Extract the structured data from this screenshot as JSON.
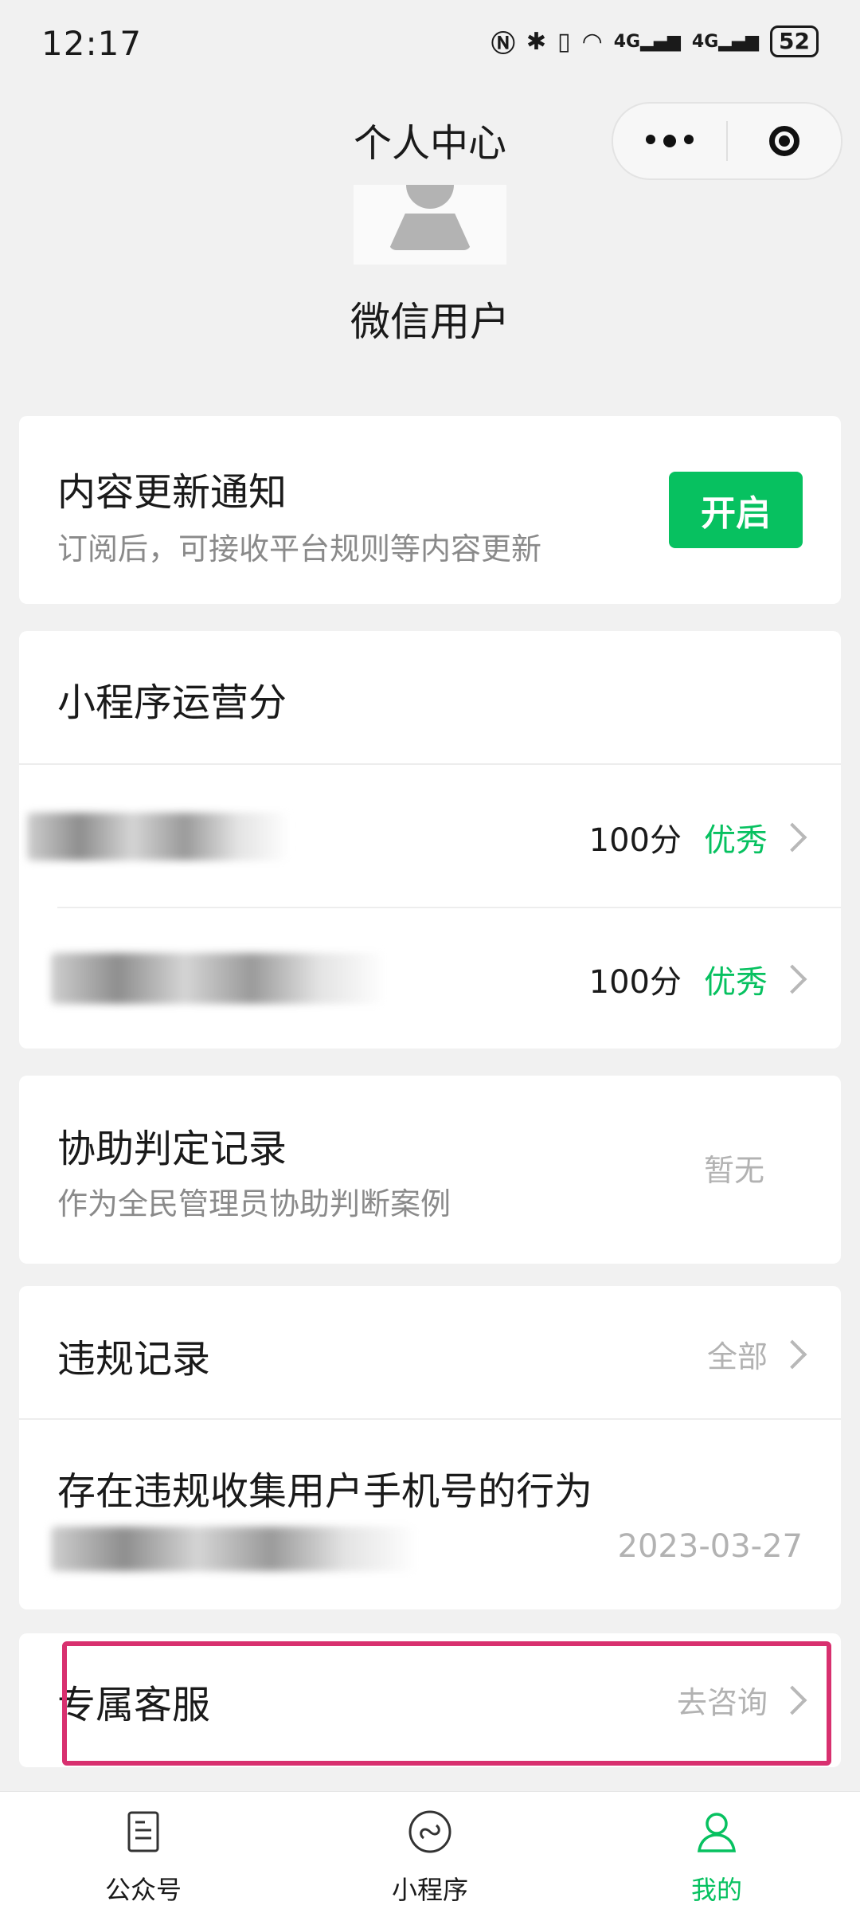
{
  "status_bar": {
    "time": "12:17",
    "battery": "52",
    "net1": "4G",
    "net2": "4G"
  },
  "header": {
    "title": "个人中心"
  },
  "profile": {
    "nickname": "微信用户"
  },
  "notify_card": {
    "title": "内容更新通知",
    "subtitle": "订阅后，可接收平台规则等内容更新",
    "button": "开启"
  },
  "score_card": {
    "title": "小程序运营分",
    "items": [
      {
        "score": "100分",
        "rating": "优秀"
      },
      {
        "score": "100分",
        "rating": "优秀"
      }
    ]
  },
  "assist_card": {
    "title": "协助判定记录",
    "subtitle": "作为全民管理员协助判断案例",
    "status": "暂无"
  },
  "violation_card": {
    "title": "违规记录",
    "action": "全部",
    "record": {
      "title": "存在违规收集用户手机号的行为",
      "date": "2023-03-27"
    }
  },
  "service_card": {
    "title": "专属客服",
    "action": "去咨询"
  },
  "tabbar": {
    "tabs": [
      {
        "label": "公众号"
      },
      {
        "label": "小程序"
      },
      {
        "label": "我的"
      }
    ]
  },
  "colors": {
    "accent": "#07c160",
    "highlight": "#d8306f"
  },
  "icons": [
    "nfc-icon",
    "bluetooth-icon",
    "vibrate-icon",
    "wifi-icon",
    "signal-icon",
    "battery-icon",
    "more-icon",
    "close-target-icon",
    "article-icon",
    "miniprogram-icon",
    "user-icon",
    "chevron-right-icon"
  ]
}
